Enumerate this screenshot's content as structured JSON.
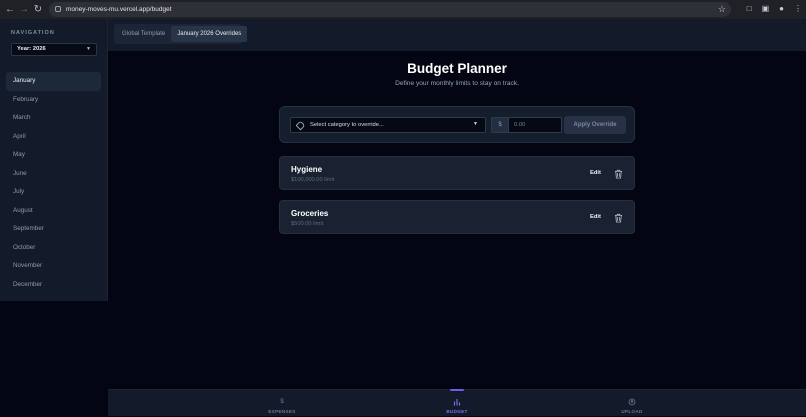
{
  "browser": {
    "url": "money-moves-mu.vercel.app/budget"
  },
  "sidebar": {
    "nav_label": "NAVIGATION",
    "year_select": "Year: 2026",
    "months": [
      "January",
      "February",
      "March",
      "April",
      "May",
      "June",
      "July",
      "August",
      "September",
      "October",
      "November",
      "December"
    ],
    "active_month": "January"
  },
  "topbar": {
    "tabs": [
      "Global Template",
      "January 2026 Overrides"
    ],
    "active_tab": "January 2026 Overrides"
  },
  "header": {
    "title": "Budget Planner",
    "subtitle": "Define your monthly limits to stay on track."
  },
  "override": {
    "category_placeholder": "Select category to override...",
    "currency_symbol": "$",
    "amount_placeholder": "0.00",
    "apply_label": "Apply Override"
  },
  "budgets": [
    {
      "name": "Hygiene",
      "limit": "$100,000.00 limit",
      "edit_label": "Edit"
    },
    {
      "name": "Groceries",
      "limit": "$500.00 limit",
      "edit_label": "Edit"
    }
  ],
  "bottom_nav": {
    "tabs": [
      {
        "label": "EXPENSES",
        "icon": "dollar-icon"
      },
      {
        "label": "BUDGET",
        "icon": "chart-icon"
      },
      {
        "label": "UPLOAD",
        "icon": "upload-icon"
      }
    ],
    "active": "BUDGET"
  },
  "colors": {
    "accent": "#6c5ce7",
    "background": "#030612",
    "panel": "#131b2a"
  }
}
